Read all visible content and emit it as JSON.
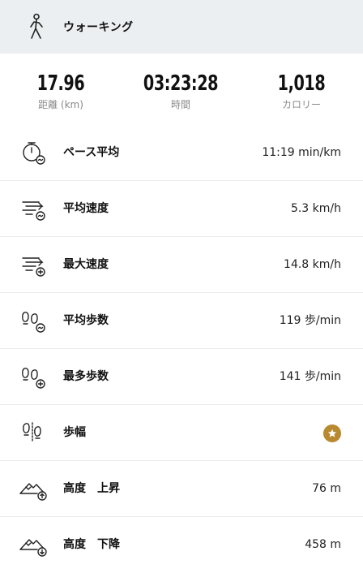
{
  "header": {
    "title": "ウォーキング",
    "icon": "walking-person-icon"
  },
  "summary": [
    {
      "value": "17.96",
      "label": "距離 (km)"
    },
    {
      "value": "03:23:28",
      "label": "時間"
    },
    {
      "value": "1,018",
      "label": "カロリー"
    }
  ],
  "metrics": [
    {
      "icon": "stopwatch-average-icon",
      "label": "ペース平均",
      "value": "11:19 min/km"
    },
    {
      "icon": "speed-average-icon",
      "label": "平均速度",
      "value": "5.3 km/h"
    },
    {
      "icon": "speed-max-icon",
      "label": "最大速度",
      "value": "14.8 km/h"
    },
    {
      "icon": "steps-average-icon",
      "label": "平均歩数",
      "value": "119 歩/min"
    },
    {
      "icon": "steps-max-icon",
      "label": "最多歩数",
      "value": "141 歩/min"
    },
    {
      "icon": "stride-icon",
      "label": "歩幅",
      "value": "",
      "badge_icon": "premium-star-icon",
      "badge_color": "#b8892f"
    },
    {
      "icon": "elevation-up-icon",
      "label": "高度　上昇",
      "value": "76 m"
    },
    {
      "icon": "elevation-down-icon",
      "label": "高度　下降",
      "value": "458 m"
    }
  ]
}
